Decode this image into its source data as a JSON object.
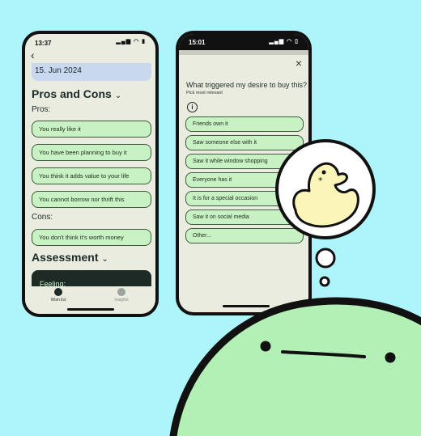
{
  "phone1": {
    "status_time": "13:37",
    "back_glyph": "‹",
    "date_value": "15. Jun 2024",
    "pros_cons_heading": "Pros and Cons",
    "chevron": "⌄",
    "pros_label": "Pros:",
    "pros": [
      "You really like it",
      "You have been planning to buy it",
      "You think it adds value to your life",
      "You cannot borrow nor thrift this"
    ],
    "cons_label": "Cons:",
    "cons": [
      "You don't think it's worth money"
    ],
    "assessment_heading": "Assessment",
    "feeling_label": "Feeling:",
    "nav": [
      {
        "label": "Wish list",
        "icon": "list-icon",
        "active": true
      },
      {
        "label": "Insights",
        "icon": "insights-icon",
        "active": false
      }
    ]
  },
  "phone2": {
    "status_time": "15:01",
    "close_glyph": "×",
    "question": "What triggered my desire to buy this?",
    "hint": "Pick most relevant",
    "info_glyph": "i",
    "options": [
      "Friends own it",
      "Saw someone else with it",
      "Saw it while window shopping",
      "Everyone has it",
      "It is for a special occasion",
      "Saw it on social media",
      "Other..."
    ]
  },
  "colors": {
    "background": "#aef4fb",
    "screen": "#e9ecdf",
    "chip_fill": "#c8f2c3",
    "chip_border": "#3d5a3d",
    "mascot": "#b3f0b6",
    "duck": "#fbf6b8",
    "dark": "#111111"
  }
}
